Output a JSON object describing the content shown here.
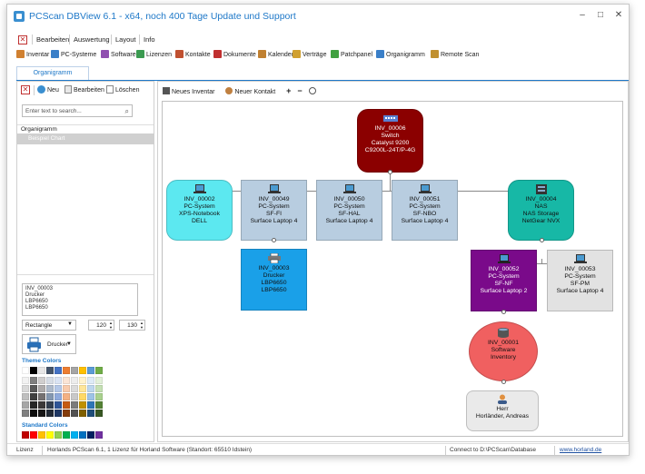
{
  "window": {
    "title": "PCScan DBView 6.1 - x64, noch 400 Tage Update und Support"
  },
  "menu": {
    "items": [
      "Bearbeiten",
      "Auswertung",
      "Layout",
      "Info"
    ]
  },
  "toolbar": {
    "items": [
      {
        "label": "Inventar",
        "icon": "inventory-icon",
        "color": "#d08030"
      },
      {
        "label": "PC-Systeme",
        "icon": "pc-icon",
        "color": "#3a7fc8"
      },
      {
        "label": "Software",
        "icon": "software-icon",
        "color": "#9050b0"
      },
      {
        "label": "Lizenzen",
        "icon": "license-icon",
        "color": "#3a9a50"
      },
      {
        "label": "Kontakte",
        "icon": "contacts-icon",
        "color": "#c05030"
      },
      {
        "label": "Dokumente",
        "icon": "documents-icon",
        "color": "#c03030"
      },
      {
        "label": "Kalender",
        "icon": "calendar-icon",
        "color": "#c08030"
      },
      {
        "label": "Verträge",
        "icon": "contract-icon",
        "color": "#d0a030"
      },
      {
        "label": "Patchpanel",
        "icon": "patchpanel-icon",
        "color": "#40a040"
      },
      {
        "label": "Organigramm",
        "icon": "orgchart-icon",
        "color": "#3a7fc8"
      },
      {
        "label": "Remote Scan",
        "icon": "remote-scan-icon",
        "color": "#c09030"
      }
    ]
  },
  "tabs": {
    "active": "Organigramm"
  },
  "left": {
    "toolbar": {
      "new": "Neu",
      "edit": "Bearbeiten",
      "delete": "Löschen"
    },
    "search": {
      "placeholder": "Enter text to search..."
    },
    "tree": {
      "header": "Organigramm",
      "selected": "Beispiel Chart"
    },
    "textbox": [
      "INV_00003",
      "Drucker",
      "LBP6650",
      "LBP6650"
    ],
    "shape": "Rectangle",
    "width": "120",
    "height": "130",
    "icon_label": "Drucker",
    "theme_colors_label": "Theme Colors",
    "standard_colors_label": "Standard Colors",
    "theme_top": [
      "#ffffff",
      "#000000",
      "#e7e6e6",
      "#44546a",
      "#4472c4",
      "#ed7d31",
      "#a5a5a5",
      "#ffc000",
      "#5b9bd5",
      "#70ad47"
    ],
    "theme_grid": [
      [
        "#f2f2f2",
        "#7f7f7f",
        "#d0cece",
        "#d6dce5",
        "#dae3f3",
        "#fbe5d6",
        "#ededed",
        "#fff2cc",
        "#deebf7",
        "#e2f0d9"
      ],
      [
        "#d9d9d9",
        "#595959",
        "#aeabab",
        "#adb9ca",
        "#b4c7e7",
        "#f8cbad",
        "#dbdbdb",
        "#ffe699",
        "#bdd7ee",
        "#c5e0b4"
      ],
      [
        "#bfbfbf",
        "#404040",
        "#757171",
        "#8497b0",
        "#8faadc",
        "#f4b183",
        "#c9c9c9",
        "#ffd966",
        "#9dc3e6",
        "#a9d18e"
      ],
      [
        "#a6a6a6",
        "#262626",
        "#3b3838",
        "#333f50",
        "#2f5597",
        "#c55a11",
        "#7b7b7b",
        "#bf9000",
        "#2e75b6",
        "#548235"
      ],
      [
        "#808080",
        "#0d0d0d",
        "#171616",
        "#222a35",
        "#1f3864",
        "#843c0c",
        "#525252",
        "#7f6000",
        "#1f4e79",
        "#385723"
      ]
    ],
    "standard": [
      "#c00000",
      "#ff0000",
      "#ffc000",
      "#ffff00",
      "#92d050",
      "#00b050",
      "#00b0f0",
      "#0070c0",
      "#002060",
      "#7030a0"
    ]
  },
  "canvas": {
    "toolbar": {
      "new_inventory": "Neues Inventar",
      "new_contact": "Neuer Kontakt",
      "add": "+",
      "remove": "−"
    }
  },
  "nodes": {
    "switch": {
      "lines": [
        "INV_00006",
        "Switch",
        "Catalyst 9200",
        "C9200L-24T/P-4G"
      ],
      "color": "#8b0000"
    },
    "n2": {
      "lines": [
        "INV_00002",
        "PC-System",
        "XPS-Notebook",
        "DELL"
      ],
      "color": "#5ce8f0"
    },
    "n49": {
      "lines": [
        "INV_00049",
        "PC-System",
        "SF-FI",
        "Surface Laptop 4"
      ],
      "color": "#b8cde0"
    },
    "n50": {
      "lines": [
        "INV_00050",
        "PC-System",
        "SF-HAL",
        "Surface Laptop 4"
      ],
      "color": "#b8cde0"
    },
    "n51": {
      "lines": [
        "INV_00051",
        "PC-System",
        "SF-NBO",
        "Surface Laptop 4"
      ],
      "color": "#b8cde0"
    },
    "n4": {
      "lines": [
        "INV_00004",
        "NAS",
        "NAS Storage",
        "NetGear NVX"
      ],
      "color": "#17b8a6"
    },
    "n3": {
      "lines": [
        "INV_00003",
        "Drucker",
        "LBP6650",
        "LBP6650"
      ],
      "color": "#1aa0e8"
    },
    "n52": {
      "lines": [
        "INV_00052",
        "PC-System",
        "SF-NF",
        "Surface Laptop 2"
      ],
      "color": "#7a0a8a"
    },
    "n53": {
      "lines": [
        "INV_00053",
        "PC-System",
        "SF-PM",
        "Surface Laptop 4"
      ],
      "color": "#e2e2e2"
    },
    "n1": {
      "lines": [
        "INV_00001",
        "Software",
        "Inventory"
      ],
      "color": "#f06060"
    },
    "herr": {
      "lines": [
        "Herr",
        "Horländer, Andreas"
      ],
      "color": "#eaeaea"
    }
  },
  "status": {
    "lizenz": "Lizenz",
    "product": "Horlands PCScan 6.1, 1 Lizenz für Horland Software (Standort: 65510 Idstein)",
    "connect": "Connect to D:\\PCScan\\Database",
    "url": "www.horland.de"
  }
}
